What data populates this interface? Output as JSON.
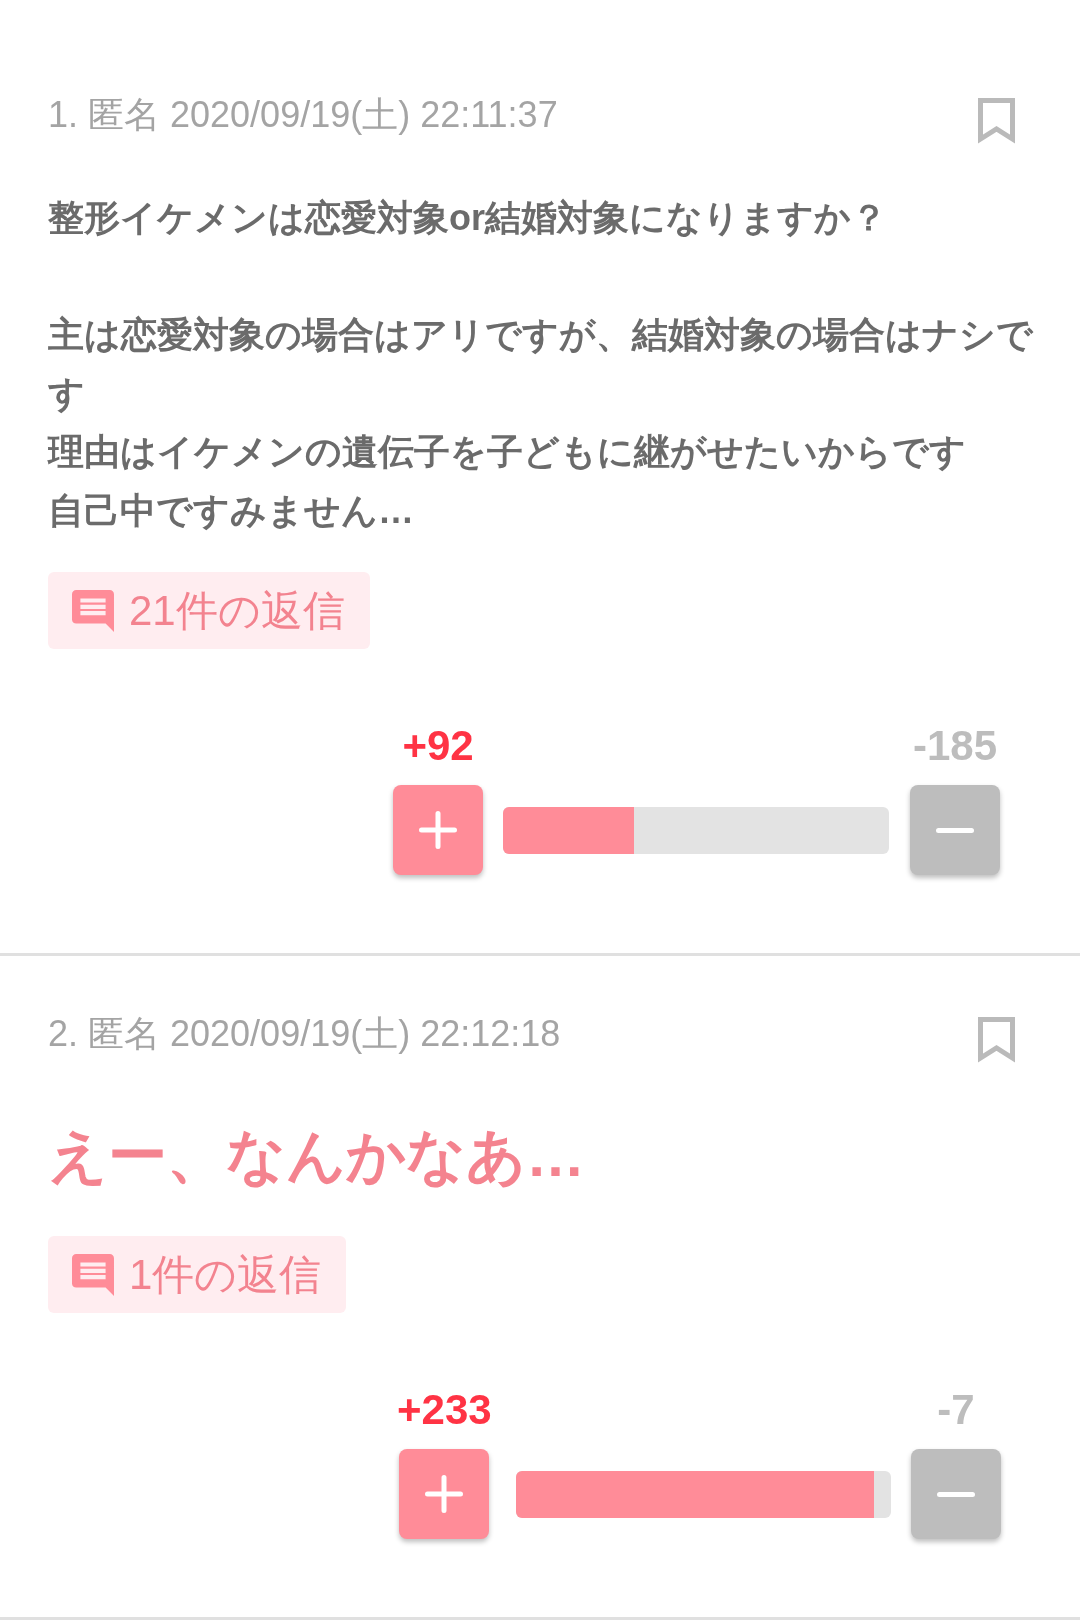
{
  "comments": [
    {
      "number": "1.",
      "author": "匿名",
      "posted_at": "2020/09/19(土) 22:11:37",
      "bookmarked": false,
      "kind": "plain",
      "body": [
        [
          "整形イケメンは恋愛対象or結婚対象になりますか？"
        ],
        [
          "主は恋愛対象の場合はアリですが、結婚対象の場合はナシです",
          "理由はイケメンの遺伝子を子どもに継がせたいからです",
          "自己中ですみません…"
        ]
      ],
      "replies": "21件の返信",
      "votes": {
        "plus": "+92",
        "minus": "-185",
        "level": 0.34
      }
    },
    {
      "number": "2.",
      "author": "匿名",
      "posted_at": "2020/09/19(土) 22:12:18",
      "bookmarked": false,
      "kind": "emphasized",
      "body": [
        [
          "えー、なんかなあ…"
        ]
      ],
      "replies": "1件の返信",
      "votes": {
        "plus": "+233",
        "minus": "-7",
        "level": 0.955
      }
    }
  ]
}
